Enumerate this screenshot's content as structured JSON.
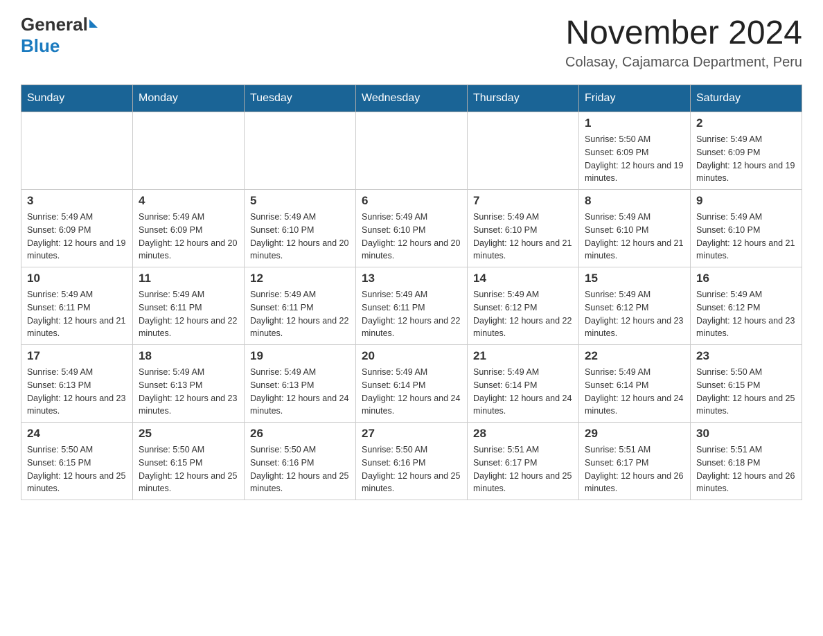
{
  "header": {
    "logo_general": "General",
    "logo_blue": "Blue",
    "title": "November 2024",
    "subtitle": "Colasay, Cajamarca Department, Peru"
  },
  "days_of_week": [
    "Sunday",
    "Monday",
    "Tuesday",
    "Wednesday",
    "Thursday",
    "Friday",
    "Saturday"
  ],
  "weeks": [
    [
      {
        "day": "",
        "sunrise": "",
        "sunset": "",
        "daylight": ""
      },
      {
        "day": "",
        "sunrise": "",
        "sunset": "",
        "daylight": ""
      },
      {
        "day": "",
        "sunrise": "",
        "sunset": "",
        "daylight": ""
      },
      {
        "day": "",
        "sunrise": "",
        "sunset": "",
        "daylight": ""
      },
      {
        "day": "",
        "sunrise": "",
        "sunset": "",
        "daylight": ""
      },
      {
        "day": "1",
        "sunrise": "Sunrise: 5:50 AM",
        "sunset": "Sunset: 6:09 PM",
        "daylight": "Daylight: 12 hours and 19 minutes."
      },
      {
        "day": "2",
        "sunrise": "Sunrise: 5:49 AM",
        "sunset": "Sunset: 6:09 PM",
        "daylight": "Daylight: 12 hours and 19 minutes."
      }
    ],
    [
      {
        "day": "3",
        "sunrise": "Sunrise: 5:49 AM",
        "sunset": "Sunset: 6:09 PM",
        "daylight": "Daylight: 12 hours and 19 minutes."
      },
      {
        "day": "4",
        "sunrise": "Sunrise: 5:49 AM",
        "sunset": "Sunset: 6:09 PM",
        "daylight": "Daylight: 12 hours and 20 minutes."
      },
      {
        "day": "5",
        "sunrise": "Sunrise: 5:49 AM",
        "sunset": "Sunset: 6:10 PM",
        "daylight": "Daylight: 12 hours and 20 minutes."
      },
      {
        "day": "6",
        "sunrise": "Sunrise: 5:49 AM",
        "sunset": "Sunset: 6:10 PM",
        "daylight": "Daylight: 12 hours and 20 minutes."
      },
      {
        "day": "7",
        "sunrise": "Sunrise: 5:49 AM",
        "sunset": "Sunset: 6:10 PM",
        "daylight": "Daylight: 12 hours and 21 minutes."
      },
      {
        "day": "8",
        "sunrise": "Sunrise: 5:49 AM",
        "sunset": "Sunset: 6:10 PM",
        "daylight": "Daylight: 12 hours and 21 minutes."
      },
      {
        "day": "9",
        "sunrise": "Sunrise: 5:49 AM",
        "sunset": "Sunset: 6:10 PM",
        "daylight": "Daylight: 12 hours and 21 minutes."
      }
    ],
    [
      {
        "day": "10",
        "sunrise": "Sunrise: 5:49 AM",
        "sunset": "Sunset: 6:11 PM",
        "daylight": "Daylight: 12 hours and 21 minutes."
      },
      {
        "day": "11",
        "sunrise": "Sunrise: 5:49 AM",
        "sunset": "Sunset: 6:11 PM",
        "daylight": "Daylight: 12 hours and 22 minutes."
      },
      {
        "day": "12",
        "sunrise": "Sunrise: 5:49 AM",
        "sunset": "Sunset: 6:11 PM",
        "daylight": "Daylight: 12 hours and 22 minutes."
      },
      {
        "day": "13",
        "sunrise": "Sunrise: 5:49 AM",
        "sunset": "Sunset: 6:11 PM",
        "daylight": "Daylight: 12 hours and 22 minutes."
      },
      {
        "day": "14",
        "sunrise": "Sunrise: 5:49 AM",
        "sunset": "Sunset: 6:12 PM",
        "daylight": "Daylight: 12 hours and 22 minutes."
      },
      {
        "day": "15",
        "sunrise": "Sunrise: 5:49 AM",
        "sunset": "Sunset: 6:12 PM",
        "daylight": "Daylight: 12 hours and 23 minutes."
      },
      {
        "day": "16",
        "sunrise": "Sunrise: 5:49 AM",
        "sunset": "Sunset: 6:12 PM",
        "daylight": "Daylight: 12 hours and 23 minutes."
      }
    ],
    [
      {
        "day": "17",
        "sunrise": "Sunrise: 5:49 AM",
        "sunset": "Sunset: 6:13 PM",
        "daylight": "Daylight: 12 hours and 23 minutes."
      },
      {
        "day": "18",
        "sunrise": "Sunrise: 5:49 AM",
        "sunset": "Sunset: 6:13 PM",
        "daylight": "Daylight: 12 hours and 23 minutes."
      },
      {
        "day": "19",
        "sunrise": "Sunrise: 5:49 AM",
        "sunset": "Sunset: 6:13 PM",
        "daylight": "Daylight: 12 hours and 24 minutes."
      },
      {
        "day": "20",
        "sunrise": "Sunrise: 5:49 AM",
        "sunset": "Sunset: 6:14 PM",
        "daylight": "Daylight: 12 hours and 24 minutes."
      },
      {
        "day": "21",
        "sunrise": "Sunrise: 5:49 AM",
        "sunset": "Sunset: 6:14 PM",
        "daylight": "Daylight: 12 hours and 24 minutes."
      },
      {
        "day": "22",
        "sunrise": "Sunrise: 5:49 AM",
        "sunset": "Sunset: 6:14 PM",
        "daylight": "Daylight: 12 hours and 24 minutes."
      },
      {
        "day": "23",
        "sunrise": "Sunrise: 5:50 AM",
        "sunset": "Sunset: 6:15 PM",
        "daylight": "Daylight: 12 hours and 25 minutes."
      }
    ],
    [
      {
        "day": "24",
        "sunrise": "Sunrise: 5:50 AM",
        "sunset": "Sunset: 6:15 PM",
        "daylight": "Daylight: 12 hours and 25 minutes."
      },
      {
        "day": "25",
        "sunrise": "Sunrise: 5:50 AM",
        "sunset": "Sunset: 6:15 PM",
        "daylight": "Daylight: 12 hours and 25 minutes."
      },
      {
        "day": "26",
        "sunrise": "Sunrise: 5:50 AM",
        "sunset": "Sunset: 6:16 PM",
        "daylight": "Daylight: 12 hours and 25 minutes."
      },
      {
        "day": "27",
        "sunrise": "Sunrise: 5:50 AM",
        "sunset": "Sunset: 6:16 PM",
        "daylight": "Daylight: 12 hours and 25 minutes."
      },
      {
        "day": "28",
        "sunrise": "Sunrise: 5:51 AM",
        "sunset": "Sunset: 6:17 PM",
        "daylight": "Daylight: 12 hours and 25 minutes."
      },
      {
        "day": "29",
        "sunrise": "Sunrise: 5:51 AM",
        "sunset": "Sunset: 6:17 PM",
        "daylight": "Daylight: 12 hours and 26 minutes."
      },
      {
        "day": "30",
        "sunrise": "Sunrise: 5:51 AM",
        "sunset": "Sunset: 6:18 PM",
        "daylight": "Daylight: 12 hours and 26 minutes."
      }
    ]
  ]
}
